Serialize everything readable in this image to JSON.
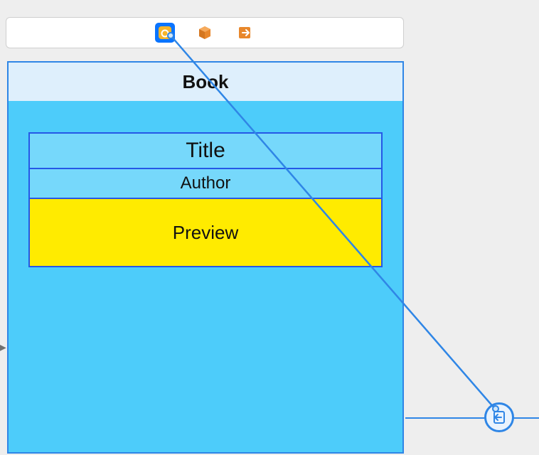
{
  "toolbar": {
    "icons": [
      {
        "name": "view-controller-icon",
        "selected": true
      },
      {
        "name": "object-cube-icon",
        "selected": false
      },
      {
        "name": "exit-icon",
        "selected": false
      }
    ]
  },
  "panel": {
    "header_title": "Book",
    "fields": {
      "title_label": "Title",
      "author_label": "Author",
      "preview_label": "Preview"
    }
  },
  "colors": {
    "selection_blue": "#0a74ff",
    "border_blue": "#2f86e6",
    "field_border": "#2558e6",
    "body_cyan": "#4dccfa",
    "field_cyan": "#76d8fb",
    "highlight_yellow": "#ffeb00",
    "header_light": "#deeffc",
    "orange": "#e8872b"
  }
}
